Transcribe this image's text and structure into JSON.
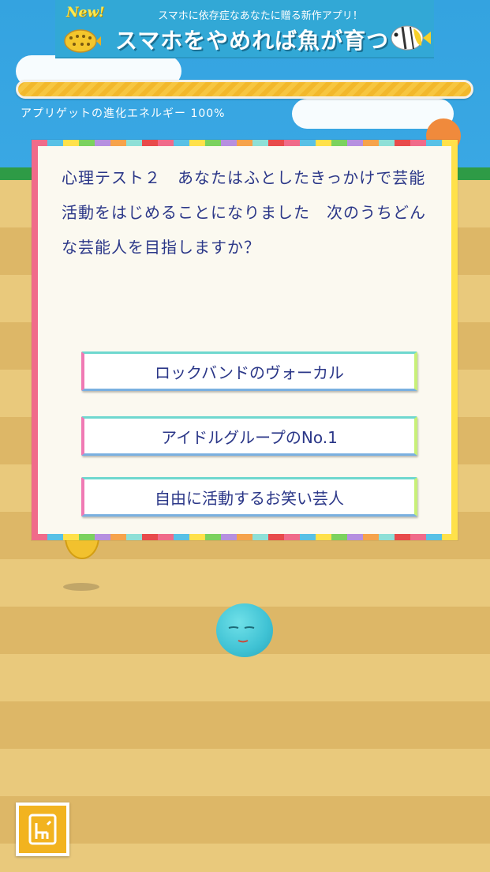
{
  "banner": {
    "new_label": "New!",
    "subtitle": "スマホに依存症なあなたに贈る新作アプリ！",
    "title": "スマホをやめれば魚が育つ"
  },
  "progress": {
    "label": "アプリゲットの進化エネルギー 100%",
    "value": 1.0
  },
  "question": {
    "text": "心理テスト２　あなたはふとしたきっかけで芸能活動をはじめることになりました　次のうちどんな芸能人を目指しますか？"
  },
  "answers": [
    {
      "label": "ロックバンドのヴォーカル"
    },
    {
      "label": "アイドルグループのNo.1"
    },
    {
      "label": "自由に活動するお笑い芸人"
    }
  ],
  "colors": {
    "sky": "#34a3e0",
    "sand": "#e9c97c",
    "question_text": "#2b3788",
    "progress_fill": "#f2b82c",
    "menu_button": "#f2b31f"
  },
  "icons": {
    "menu": "book-icon"
  }
}
